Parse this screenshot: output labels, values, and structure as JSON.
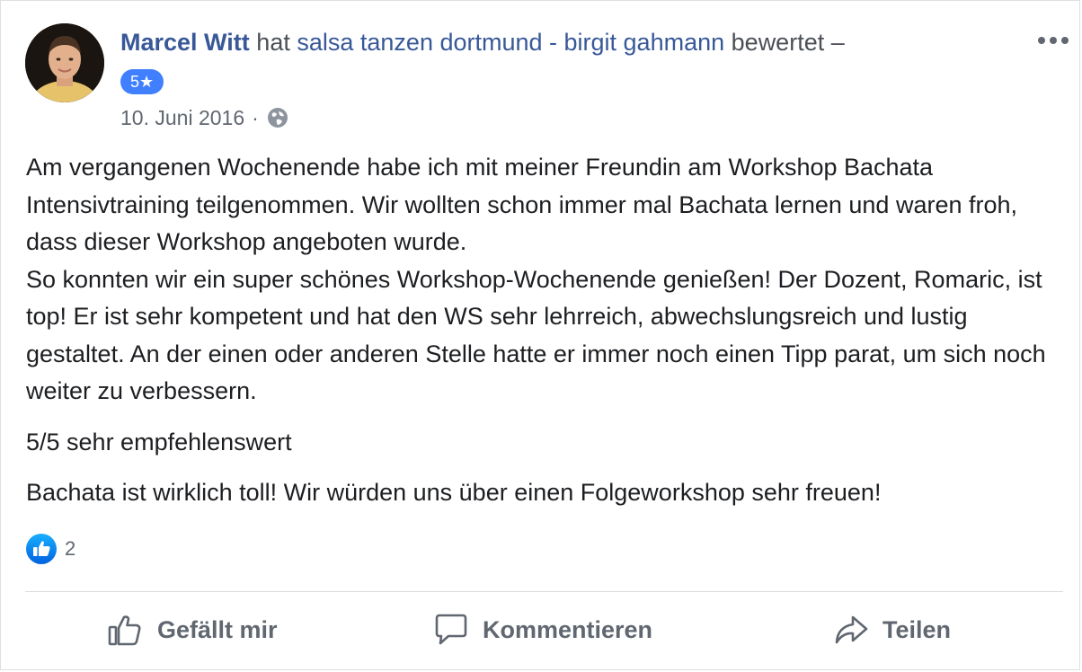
{
  "post": {
    "author": "Marcel Witt",
    "action_text": "hat",
    "page_name": "salsa tanzen dortmund - birgit gahmann",
    "action_suffix": "bewertet –",
    "rating_label": "5★",
    "date": "10. Juni 2016",
    "separator": "·",
    "privacy_icon": "globe-icon",
    "more_icon": "more-options-icon",
    "body": [
      "Am vergangenen Wochenende habe ich mit meiner Freundin am Workshop Bachata Intensivtraining teilgenommen. Wir wollten schon immer mal Bachata lernen und waren froh, dass dieser Workshop angeboten wurde.",
      "So konnten wir ein super schönes Workshop-Wochenende genießen! Der Dozent, Romaric, ist top! Er ist sehr kompetent und hat den WS sehr lehrreich, abwechslungsreich und lustig gestaltet. An der einen oder anderen Stelle hatte er immer noch einen Tipp parat, um sich noch weiter zu verbessern.",
      "5/5 sehr empfehlenswert",
      "Bachata ist wirklich toll! Wir würden uns über einen Folgeworkshop sehr freuen!"
    ],
    "reactions": {
      "icon": "like-reaction-icon",
      "count": "2"
    }
  },
  "actions": {
    "like_label": "Gefällt mir",
    "comment_label": "Kommentieren",
    "share_label": "Teilen"
  },
  "colors": {
    "link": "#385898",
    "badge": "#4080ff",
    "muted": "#606770"
  }
}
